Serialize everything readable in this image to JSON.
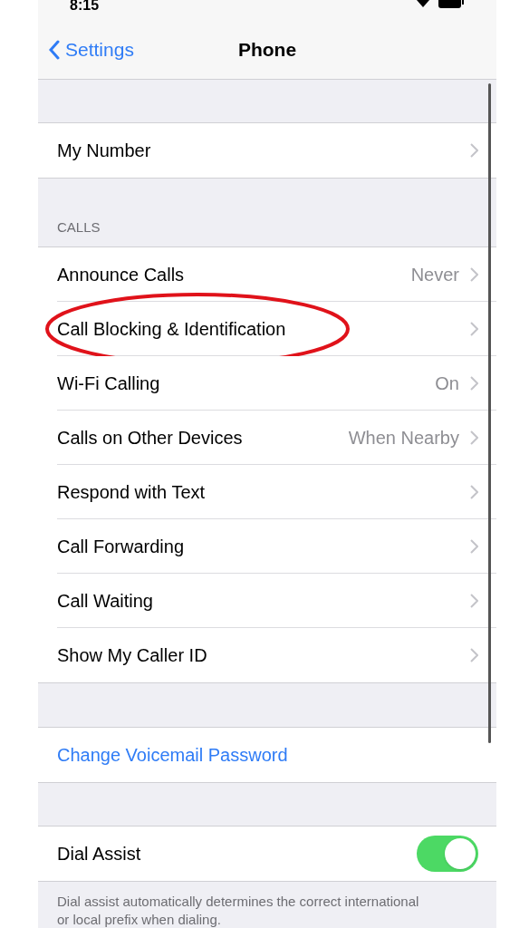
{
  "status_bar": {
    "time": "8:15"
  },
  "nav": {
    "back": "Settings",
    "title": "Phone"
  },
  "groups": [
    {
      "rows": [
        {
          "kind": "link",
          "label": "My Number",
          "highlighted": false
        }
      ]
    },
    {
      "header": "CALLS",
      "rows": [
        {
          "kind": "link",
          "label": "Announce Calls",
          "value": "Never",
          "highlighted": false
        },
        {
          "kind": "link",
          "label": "Call Blocking & Identification",
          "highlighted": true
        },
        {
          "kind": "link",
          "label": "Wi-Fi Calling",
          "value": "On",
          "highlighted": false
        },
        {
          "kind": "link",
          "label": "Calls on Other Devices",
          "value": "When Nearby",
          "highlighted": false
        },
        {
          "kind": "link",
          "label": "Respond with Text",
          "highlighted": false
        },
        {
          "kind": "link",
          "label": "Call Forwarding",
          "highlighted": false
        },
        {
          "kind": "link",
          "label": "Call Waiting",
          "highlighted": false
        },
        {
          "kind": "link",
          "label": "Show My Caller ID",
          "highlighted": false
        }
      ]
    },
    {
      "rows": [
        {
          "kind": "action",
          "label": "Change Voicemail Password",
          "highlighted": false
        }
      ]
    },
    {
      "rows": [
        {
          "kind": "toggle",
          "label": "Dial Assist",
          "on": true,
          "highlighted": false
        }
      ],
      "footer": "Dial assist automatically determines the correct international or local prefix when dialing."
    }
  ]
}
